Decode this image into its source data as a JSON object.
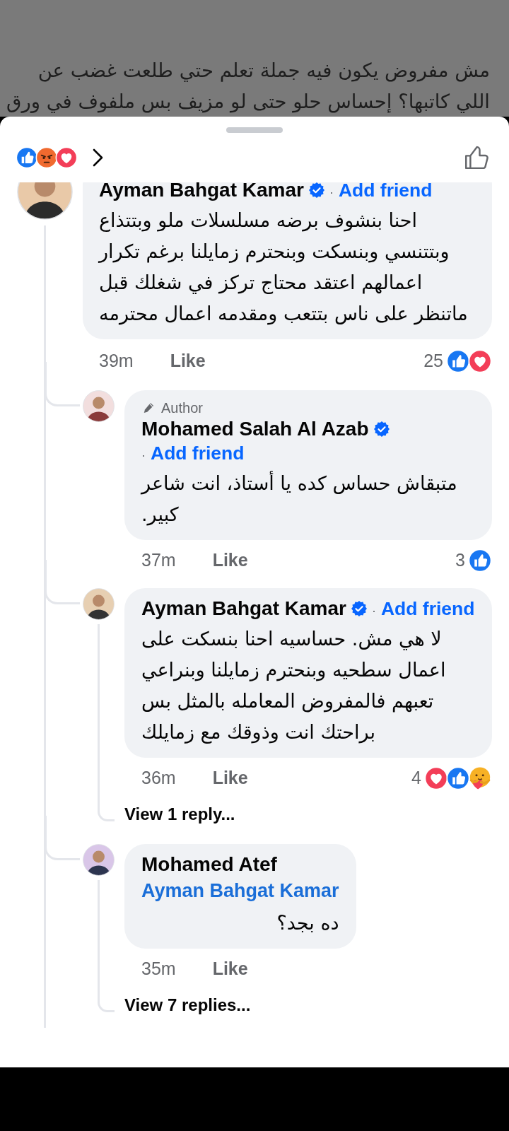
{
  "post_background": {
    "lines": [
      "مش مفروض يكون فيه جملة تعلم حتي طلعت غضب عن",
      "اللي كاتبها؟ إحساس حلو حتى لو مزيف بس ملفوف في ورق"
    ]
  },
  "reactions_bar": {
    "reactions": [
      {
        "kind": "like"
      },
      {
        "kind": "angry"
      },
      {
        "kind": "love"
      }
    ]
  },
  "comment": {
    "author": "Ayman Bahgat Kamar",
    "verified": true,
    "separator": "·",
    "add_friend": "Add friend",
    "right_aligned": false,
    "text": "احنا بنشوف برضه مسلسلات ملو وبتتذاع وبتتنسي وبنسكت وبنحترم زمايلنا برغم تكرار اعمالهم اعتقد  محتاج تركز في شغلك قبل ماتنظر على ناس بتتعب ومقدمه اعمال محترمه",
    "time": "39m",
    "like": "Like",
    "reaction_count": "25",
    "reactions": [
      {
        "kind": "like"
      },
      {
        "kind": "love"
      }
    ],
    "replies": [
      {
        "author_badge": "Author",
        "author": "Mohamed Salah Al Azab",
        "verified": true,
        "separator": "·",
        "add_friend": "Add friend",
        "right_aligned": false,
        "text": "متبقاش حساس كده يا أستاذ، انت شاعر كبير.",
        "time": "37m",
        "like": "Like",
        "reaction_count": "3",
        "reactions": [
          {
            "kind": "like"
          }
        ]
      },
      {
        "author": "Ayman Bahgat Kamar",
        "verified": true,
        "separator": "·",
        "add_friend": "Add friend",
        "right_aligned": false,
        "text": "لا هي مش. حساسيه احنا بنسكت على اعمال سطحيه وبنحترم زمايلنا وبنراعي تعبهم  فالمفروض المعامله بالمثل بس براحتك انت وذوقك مع زمايلك",
        "time": "36m",
        "like": "Like",
        "reaction_count": "4",
        "reactions": [
          {
            "kind": "love"
          },
          {
            "kind": "like"
          },
          {
            "kind": "care"
          }
        ],
        "view_replies": "View 1 reply..."
      },
      {
        "author": "Mohamed Atef",
        "verified": false,
        "mention": "Ayman Bahgat Kamar",
        "text": "ده بجد؟",
        "right_aligned": true,
        "time": "35m",
        "like": "Like",
        "view_replies": "View 7 replies..."
      }
    ]
  }
}
